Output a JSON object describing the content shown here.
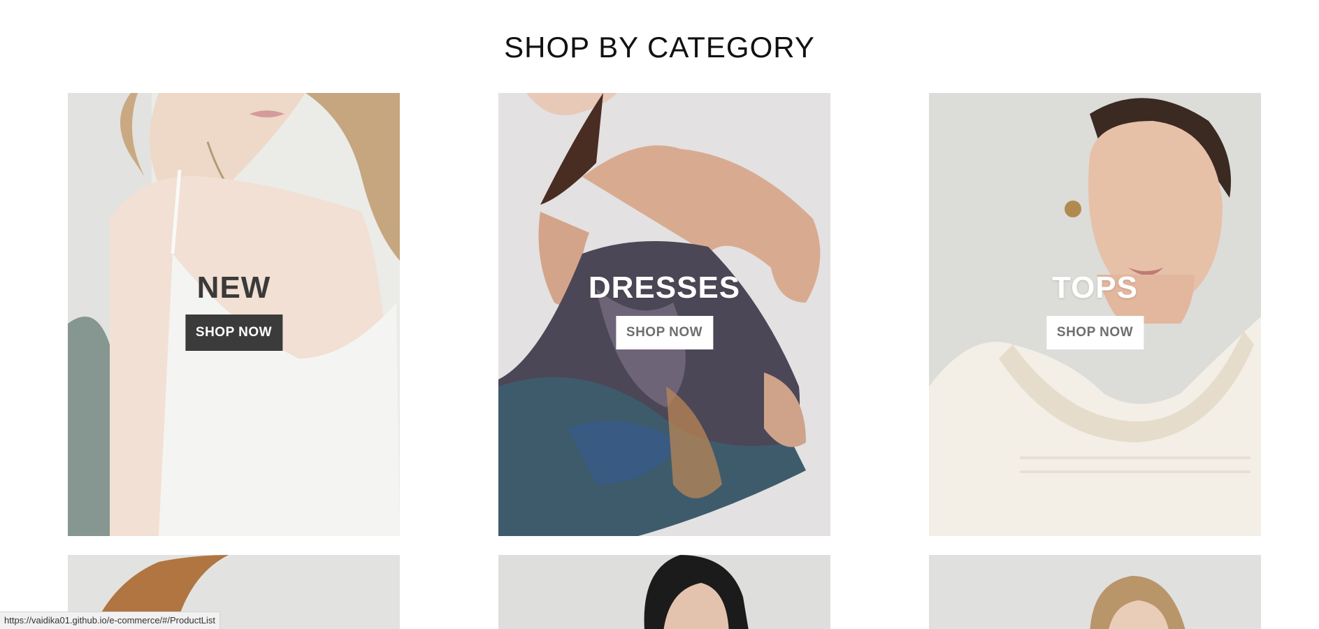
{
  "section": {
    "title": "SHOP BY CATEGORY"
  },
  "categories": [
    {
      "label": "NEW",
      "button": "SHOP NOW",
      "style": "dark"
    },
    {
      "label": "DRESSES",
      "button": "SHOP NOW",
      "style": "light"
    },
    {
      "label": "TOPS",
      "button": "SHOP NOW",
      "style": "light"
    }
  ],
  "second_row_count": 3,
  "status_bar": {
    "url": "https://vaidika01.github.io/e-commerce/#/ProductList"
  },
  "colors": {
    "dark_button": "#3b3b3b",
    "light_button": "#ffffff",
    "title_text": "#111111"
  }
}
